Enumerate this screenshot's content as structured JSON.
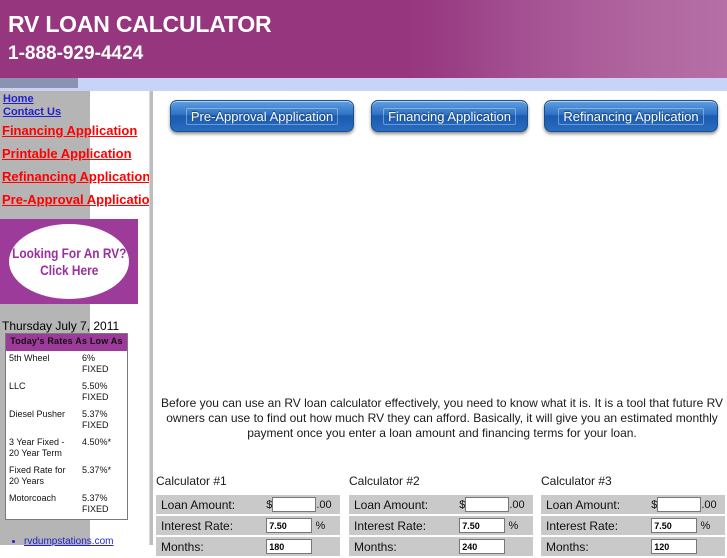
{
  "header": {
    "title": "RV LOAN CALCULATOR",
    "phone": "1-888-929-4424",
    "brand_color": "#96367f",
    "band_color": "#c7d4f7"
  },
  "sidebar": {
    "nav": [
      {
        "label": "Home",
        "style": "small"
      },
      {
        "label": "Contact Us",
        "style": "small"
      },
      {
        "label": "Financing Application",
        "style": "big"
      },
      {
        "label": "Printable Application",
        "style": "big"
      },
      {
        "label": "Refinancing Application",
        "style": "big"
      },
      {
        "label": "Pre-Approval Application",
        "style": "big"
      }
    ],
    "promo": {
      "line1": "Looking For An RV?",
      "line2": "Click Here",
      "bg_color": "#9c3b99",
      "text_color": "#9a2fa0"
    },
    "date": "Thursday July 7, 2011",
    "rates": {
      "header": "Today's Rates As Low As",
      "header_color": "#9c3b99",
      "rows": [
        {
          "name": "5th Wheel",
          "rate": "6%",
          "note": "FIXED"
        },
        {
          "name": "LLC",
          "rate": "5.50%",
          "note": "FIXED"
        },
        {
          "name": "Diesel Pusher",
          "rate": "5.37%",
          "note": "FIXED"
        },
        {
          "name": "3 Year Fixed - 20 Year Term",
          "rate": "4.50%*",
          "note": ""
        },
        {
          "name": "Fixed Rate for 20 Years",
          "rate": "5.37%*",
          "note": ""
        },
        {
          "name": "Motorcoach",
          "rate": "5.37%",
          "note": "FIXED"
        }
      ]
    },
    "bottom_link": "rvdumpstations.com"
  },
  "main": {
    "buttons": [
      {
        "label": "Pre-Approval Application"
      },
      {
        "label": "Financing Application"
      },
      {
        "label": "Refinancing Application"
      }
    ],
    "intro": "Before you can use an RV loan calculator effectively, you need to know what it is. It is a tool that future RV owners can use to find out how much RV they can afford. Basically, it will give you an estimated monthly payment once you enter a loan amount and financing terms for your loan.",
    "calculators": [
      {
        "title": "Calculator #1",
        "loan_label": "Loan Amount:",
        "loan_prefix": "$",
        "loan_suffix": ".00",
        "loan_value": "",
        "rate_label": "Interest Rate:",
        "rate_value": "7.50",
        "rate_suffix": "%",
        "months_label": "Months:",
        "months_value": "180"
      },
      {
        "title": "Calculator #2",
        "loan_label": "Loan Amount:",
        "loan_prefix": "$",
        "loan_suffix": ".00",
        "loan_value": "",
        "rate_label": "Interest Rate:",
        "rate_value": "7.50",
        "rate_suffix": "%",
        "months_label": "Months:",
        "months_value": "240"
      },
      {
        "title": "Calculator #3",
        "loan_label": "Loan Amount:",
        "loan_prefix": "$",
        "loan_suffix": ".00",
        "loan_value": "",
        "rate_label": "Interest Rate:",
        "rate_value": "7.50",
        "rate_suffix": "%",
        "months_label": "Months:",
        "months_value": "120"
      }
    ]
  }
}
